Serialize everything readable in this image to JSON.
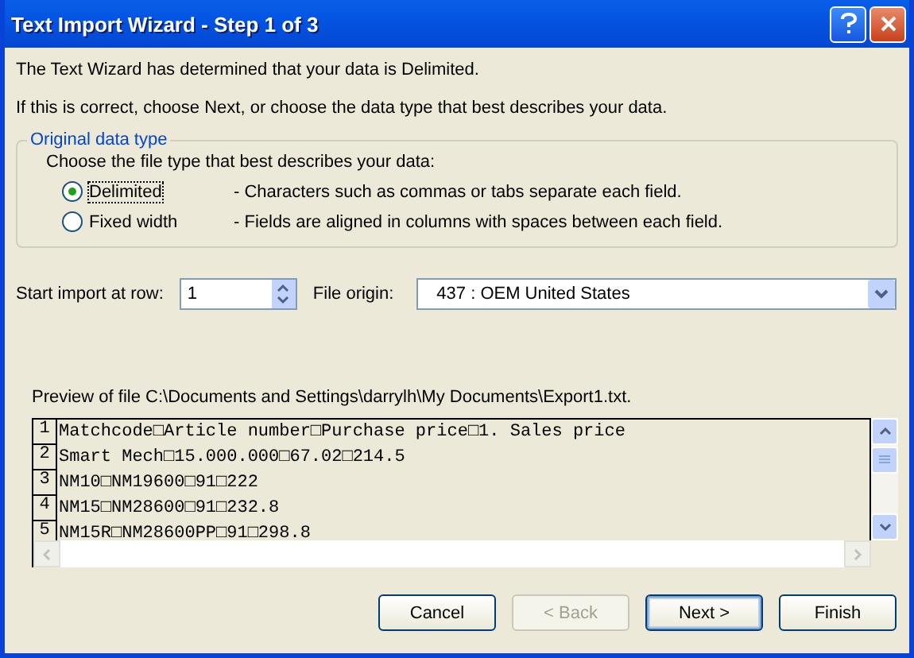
{
  "window": {
    "title": "Text Import Wizard - Step 1 of 3"
  },
  "intro": [
    "The Text Wizard has determined that your data is Delimited.",
    "If this is correct, choose Next, or choose the data type that best describes your data."
  ],
  "data_type": {
    "legend": "Original data type",
    "prompt": "Choose the file type that best describes your data:",
    "options": [
      {
        "label": "Delimited",
        "description": "- Characters such as commas or tabs separate each field.",
        "selected": true
      },
      {
        "label": "Fixed width",
        "description": "- Fields are aligned in columns with spaces between each field.",
        "selected": false
      }
    ]
  },
  "start_row": {
    "label": "Start import at row:",
    "value": "1"
  },
  "file_origin": {
    "label": "File origin:",
    "value": "437 : OEM United States"
  },
  "preview": {
    "label": "Preview of file C:\\Documents and Settings\\darrylh\\My Documents\\Export1.txt.",
    "rows": [
      {
        "number": "1",
        "text": "Matchcode□Article number□Purchase price□1. Sales price"
      },
      {
        "number": "2",
        "text": "Smart Mech□15.000.000□67.02□214.5"
      },
      {
        "number": "3",
        "text": "NM10□NM19600□91□222"
      },
      {
        "number": "4",
        "text": "NM15□NM28600□91□232.8"
      },
      {
        "number": "5",
        "text": "NM15R□NM28600PP□91□298.8"
      }
    ]
  },
  "buttons": [
    {
      "label": "Cancel",
      "disabled": false,
      "default": false
    },
    {
      "label": "< Back",
      "disabled": true,
      "default": false
    },
    {
      "label": "Next >",
      "disabled": false,
      "default": true
    },
    {
      "label": "Finish",
      "disabled": false,
      "default": false
    }
  ]
}
